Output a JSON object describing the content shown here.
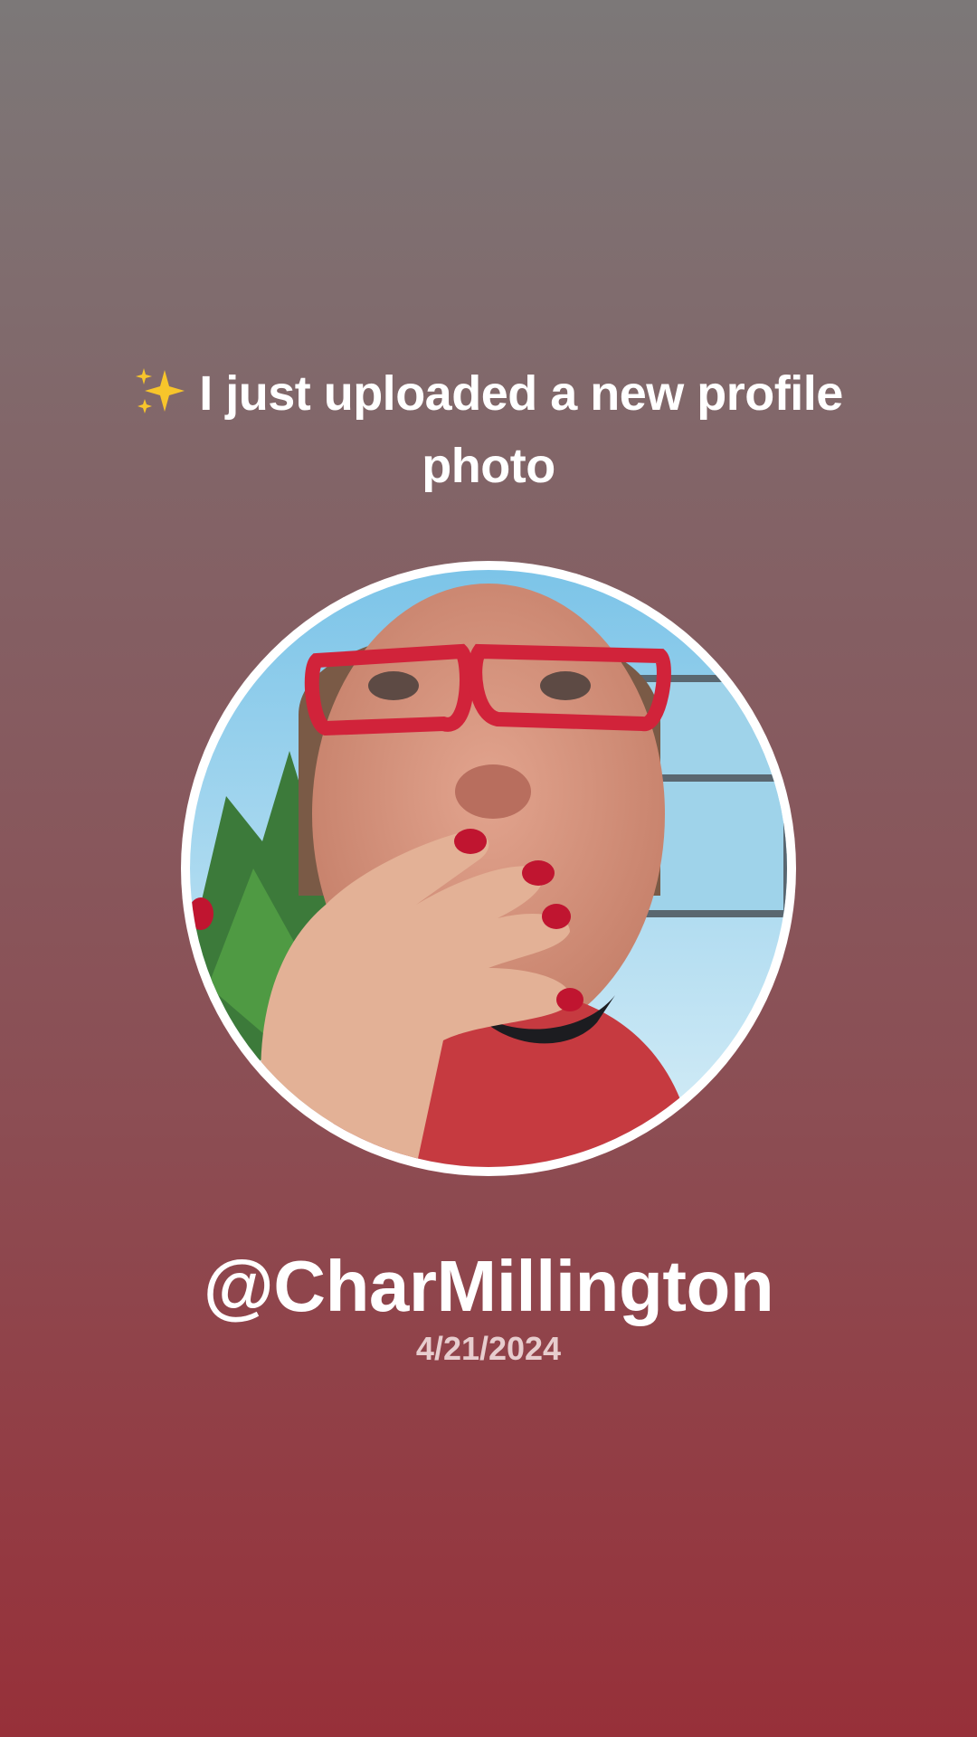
{
  "headline": {
    "icon": "sparkles-icon",
    "text": "I just uploaded a new profile photo"
  },
  "profile": {
    "avatar_icon": "profile-photo",
    "username": "@CharMillington",
    "date": "4/21/2024"
  },
  "colors": {
    "background_top": "#7c7878",
    "background_bottom": "#973039",
    "ring": "#ffffff",
    "date_text": "#e7cdce"
  }
}
